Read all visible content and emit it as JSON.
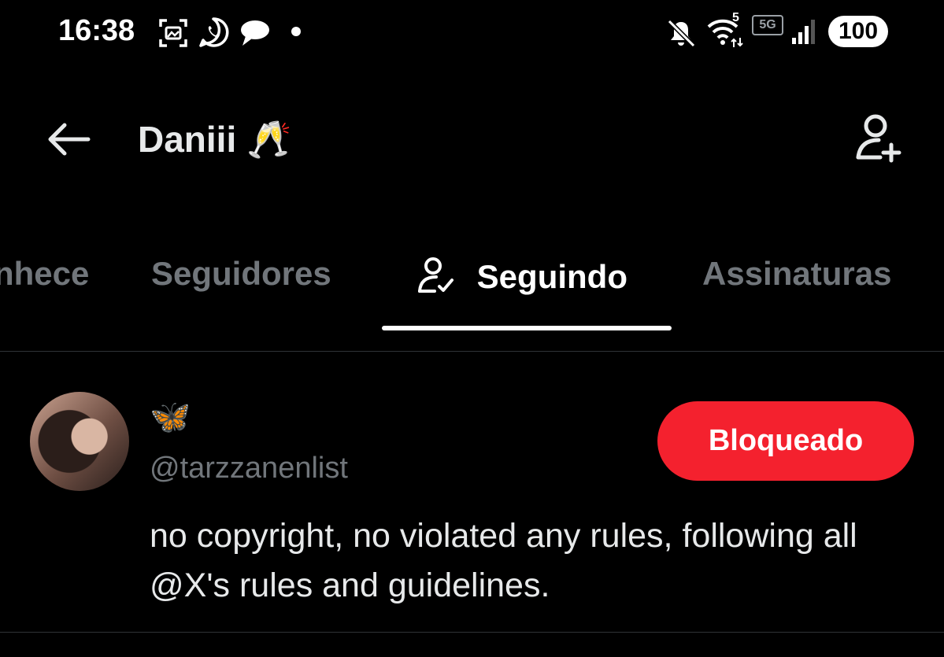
{
  "status_bar": {
    "time": "16:38",
    "network": "5G",
    "wifi_badge": "5",
    "battery": "100",
    "icons": [
      "screenshot-icon",
      "whatsapp-icon",
      "chat-bubble-icon",
      "notification-dot-icon",
      "mute-icon",
      "wifi-icon",
      "signal-icon"
    ]
  },
  "header": {
    "title": "Daniii 🥂",
    "back_icon": "arrow-left-icon",
    "action_icon": "add-user-icon"
  },
  "tabs": [
    {
      "label": "nhece",
      "active": false
    },
    {
      "label": "Seguidores",
      "active": false
    },
    {
      "label": "Seguindo",
      "active": true,
      "icon": "user-check-icon"
    },
    {
      "label": "Assinaturas",
      "active": false
    }
  ],
  "user_row": {
    "display_name": "🦋",
    "handle": "@tarzzanenlist",
    "button_label": "Bloqueado",
    "bio": "no copyright, no violated any rules, following all @X's rules and guidelines."
  },
  "colors": {
    "background": "#000000",
    "text_primary": "#e7e9ea",
    "text_secondary": "#71767b",
    "blocked_button": "#f4212e",
    "divider": "#2f3336"
  }
}
